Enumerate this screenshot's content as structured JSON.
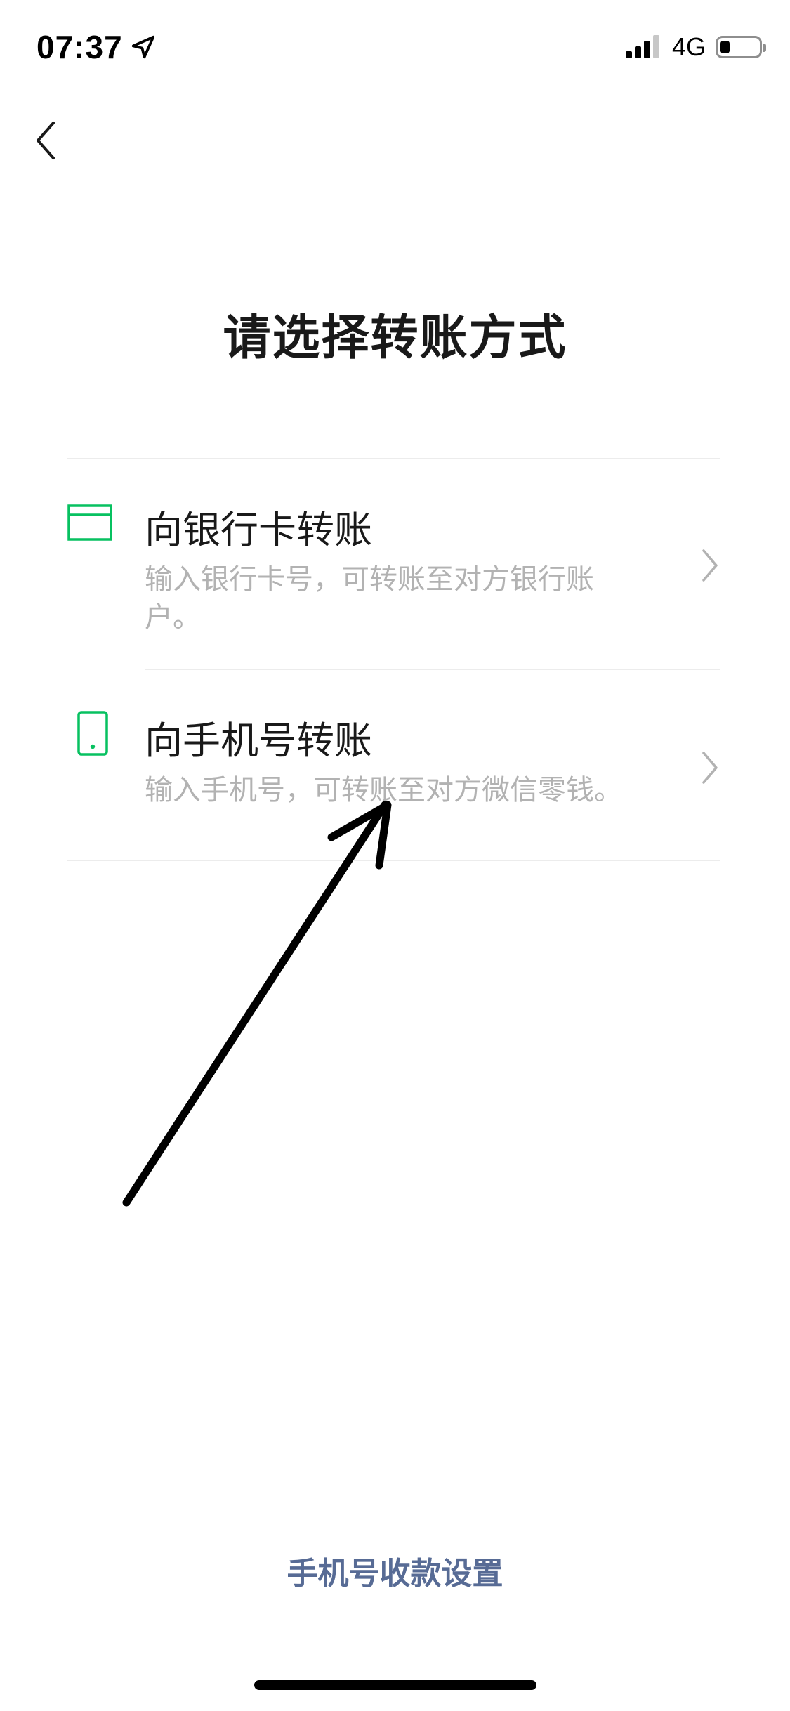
{
  "status_bar": {
    "time": "07:37",
    "network": "4G",
    "battery_level": 0.25,
    "signal_bars_active": 3,
    "signal_bars_total": 4
  },
  "header": {
    "back_icon": "chevron-left-icon"
  },
  "title": "请选择转账方式",
  "options": [
    {
      "icon": "bank-card-icon",
      "title": "向银行卡转账",
      "description": "输入银行卡号，可转账至对方银行账户。"
    },
    {
      "icon": "mobile-phone-icon",
      "title": "向手机号转账",
      "description": "输入手机号，可转账至对方微信零钱。"
    }
  ],
  "footer": {
    "settings_link": "手机号收款设置"
  },
  "colors": {
    "accent_green": "#07c160",
    "link_blue": "#576b95",
    "secondary_text": "#b2b2b2",
    "divider": "#ececec"
  }
}
